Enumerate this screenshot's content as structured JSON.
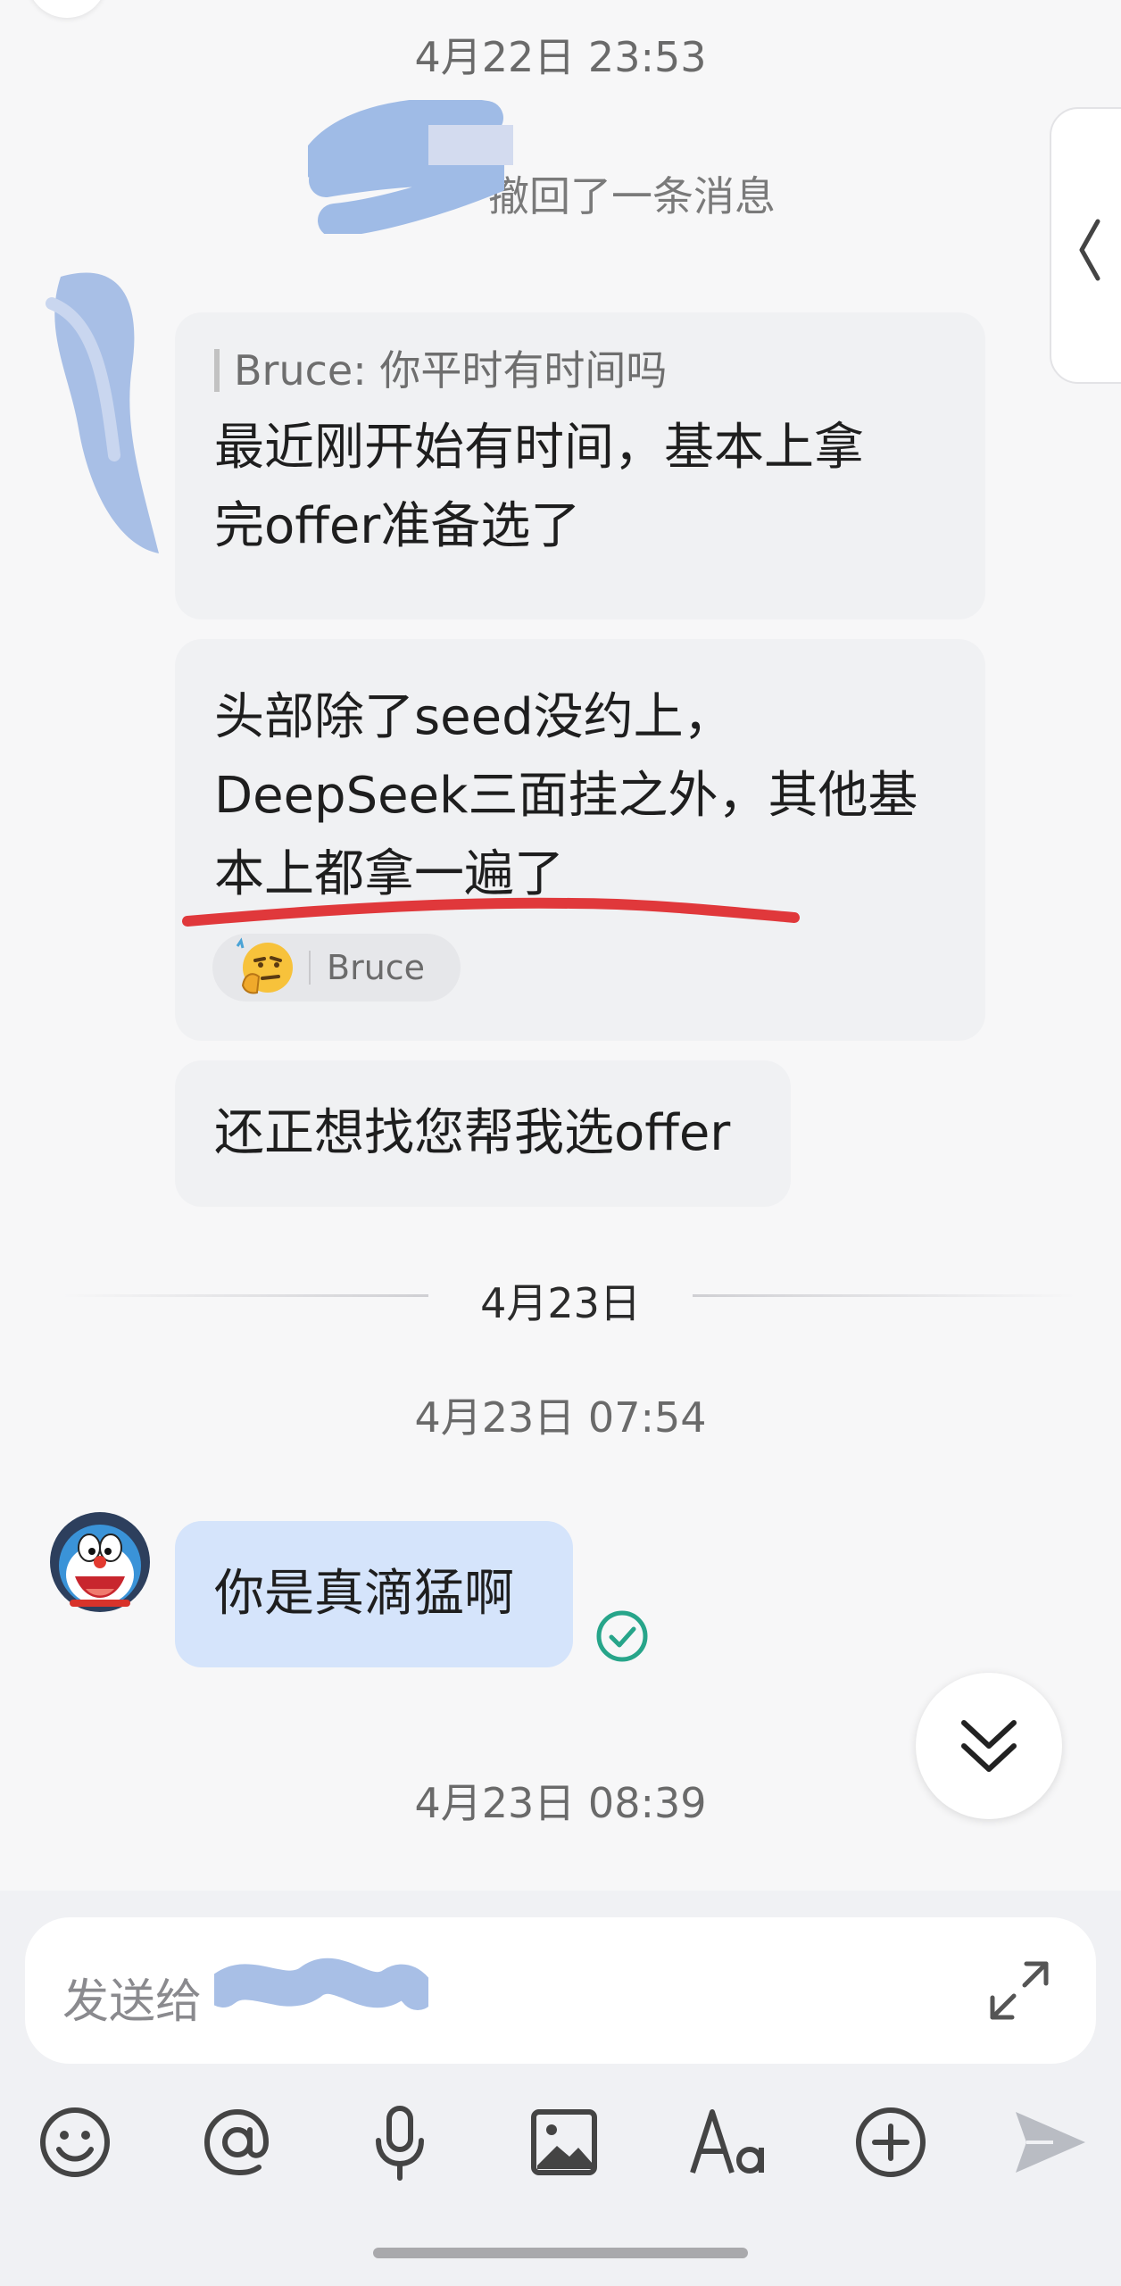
{
  "timestamps": {
    "t1": "4月22日 23:53",
    "t2": "4月23日 07:54",
    "t3": "4月23日 08:39"
  },
  "date_divider": "4月23日",
  "recall_notice": "撤回了一条消息",
  "messages": {
    "quote": "Bruce: 你平时有时间吗",
    "m1_line1": "最近刚开始有时间，基本上拿",
    "m1_line2": "完offer准备选了",
    "m2_line1": "头部除了seed没约上，",
    "m2_line2": "DeepSeek三面挂之外，其他基",
    "m2_line3": "本上都拿一遍了",
    "m2_reaction_user": "Bruce",
    "m3": "还正想找您帮我选offer",
    "mine": "你是真滴猛啊"
  },
  "input": {
    "placeholder": "发送给"
  },
  "icons": {
    "emoji": "emoji-icon",
    "mention": "at-mention-icon",
    "voice": "microphone-icon",
    "image": "image-icon",
    "format": "text-format-icon",
    "more": "plus-circle-icon",
    "send": "send-icon",
    "expand": "expand-icon",
    "scroll": "double-chevron-down-icon",
    "read": "read-check-icon"
  },
  "colors": {
    "accent_check": "#27a58a",
    "annotation_red": "#e0383b",
    "my_bubble": "#d5e4fb"
  }
}
